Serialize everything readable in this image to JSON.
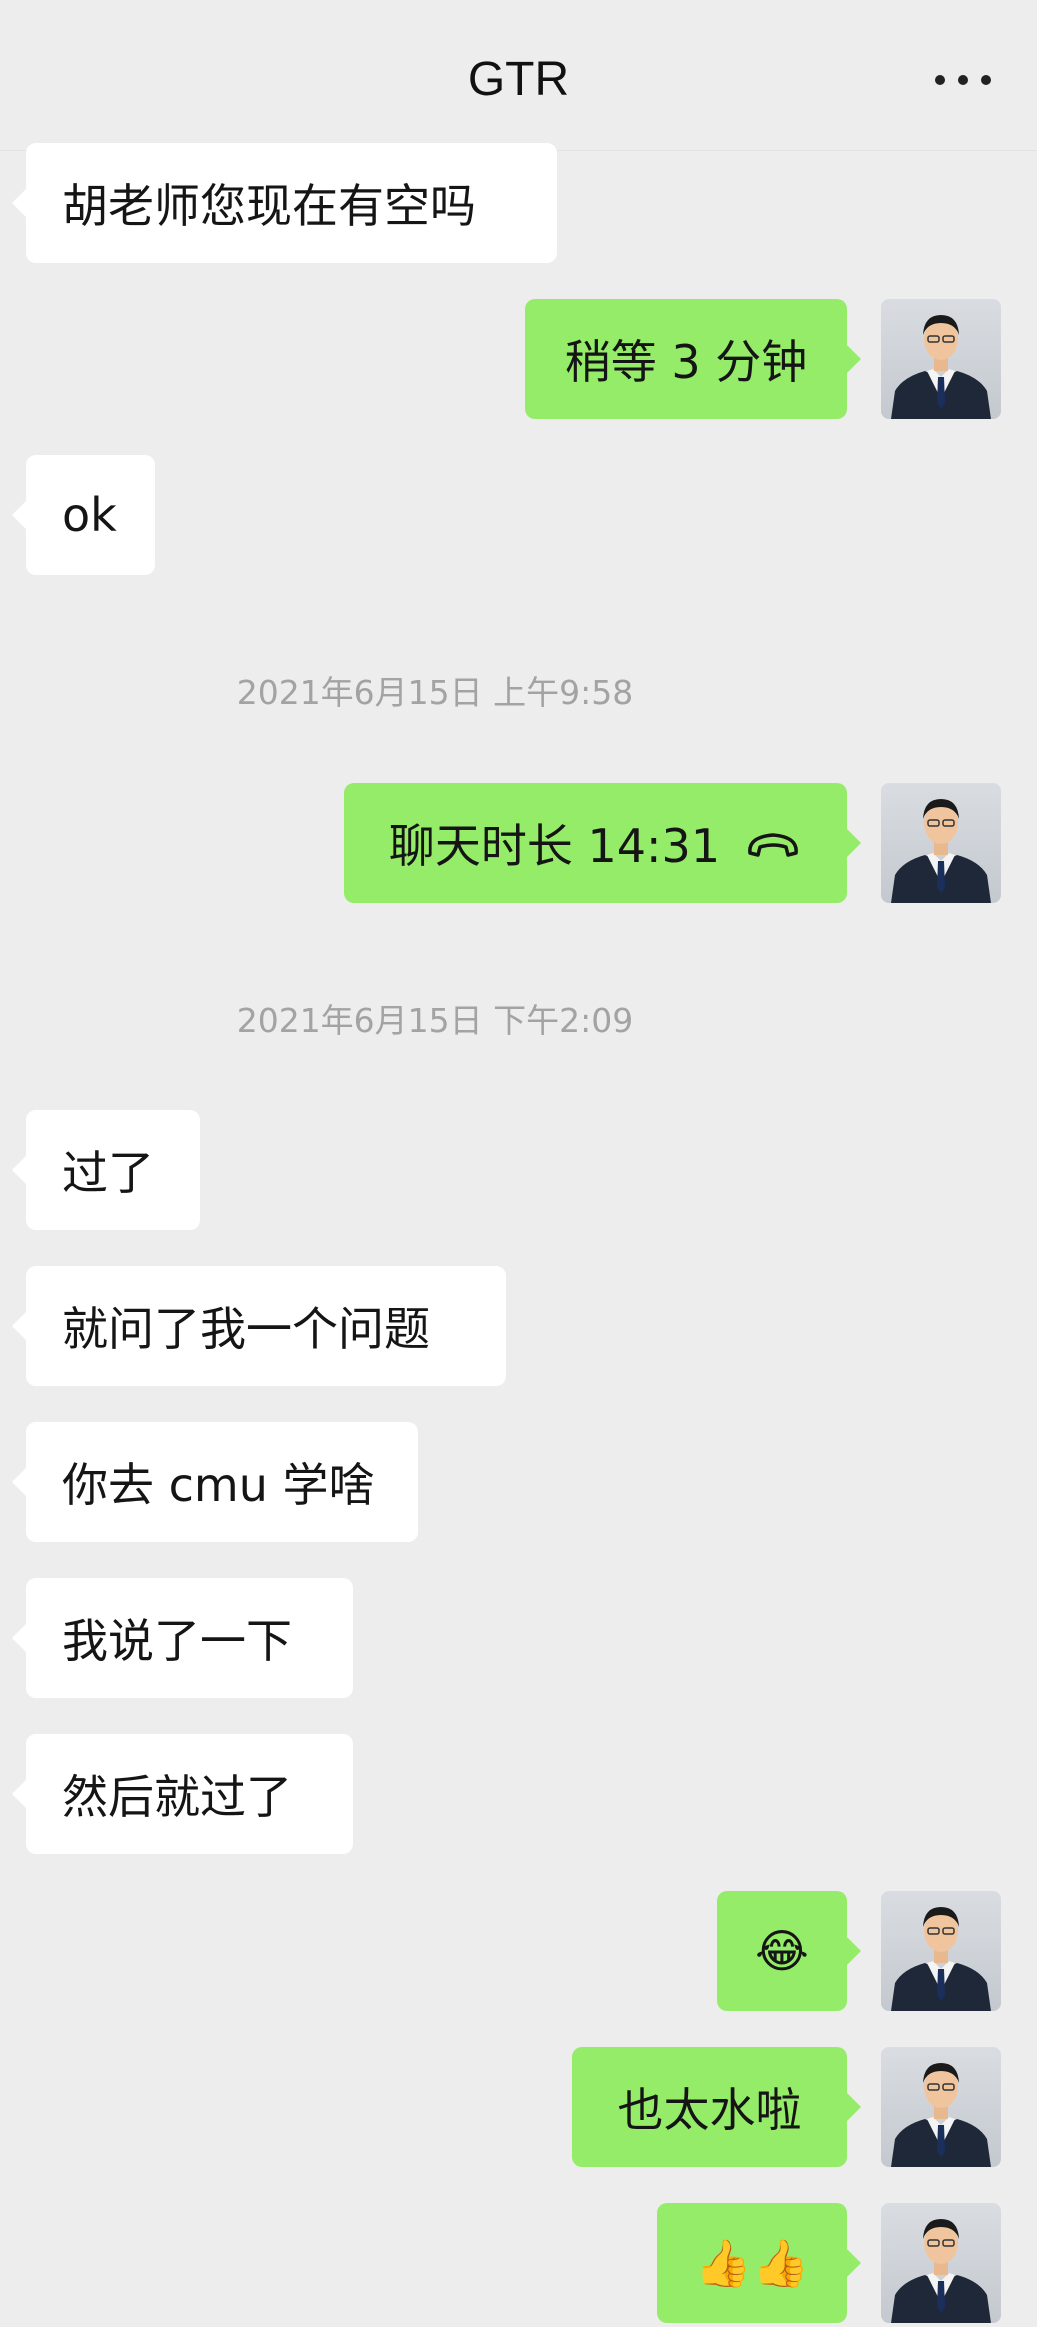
{
  "header": {
    "title": "GTR",
    "more_label": "more options"
  },
  "timestamps": [
    "2021年6月15日 上午9:58",
    "2021年6月15日 下午2:09"
  ],
  "messages": [
    {
      "side": "in",
      "text": "胡老师您现在有空吗"
    },
    {
      "side": "out",
      "text": "稍等 3 分钟"
    },
    {
      "side": "in",
      "text": "ok"
    },
    {
      "side": "out",
      "text": "聊天时长 14:31",
      "icon": "phone-hangup-icon"
    },
    {
      "side": "in",
      "text": "过了"
    },
    {
      "side": "in",
      "text": "就问了我一个问题"
    },
    {
      "side": "in",
      "text": "你去 cmu 学啥"
    },
    {
      "side": "in",
      "text": "我说了一下"
    },
    {
      "side": "in",
      "text": "然后就过了"
    },
    {
      "side": "out",
      "text": "😂"
    },
    {
      "side": "out",
      "text": "也太水啦"
    },
    {
      "side": "out",
      "text": "👍👍"
    }
  ],
  "colors": {
    "background": "#ededed",
    "outgoing_bubble": "#95ec69",
    "incoming_bubble": "#ffffff",
    "timestamp": "#a3a3a3"
  }
}
